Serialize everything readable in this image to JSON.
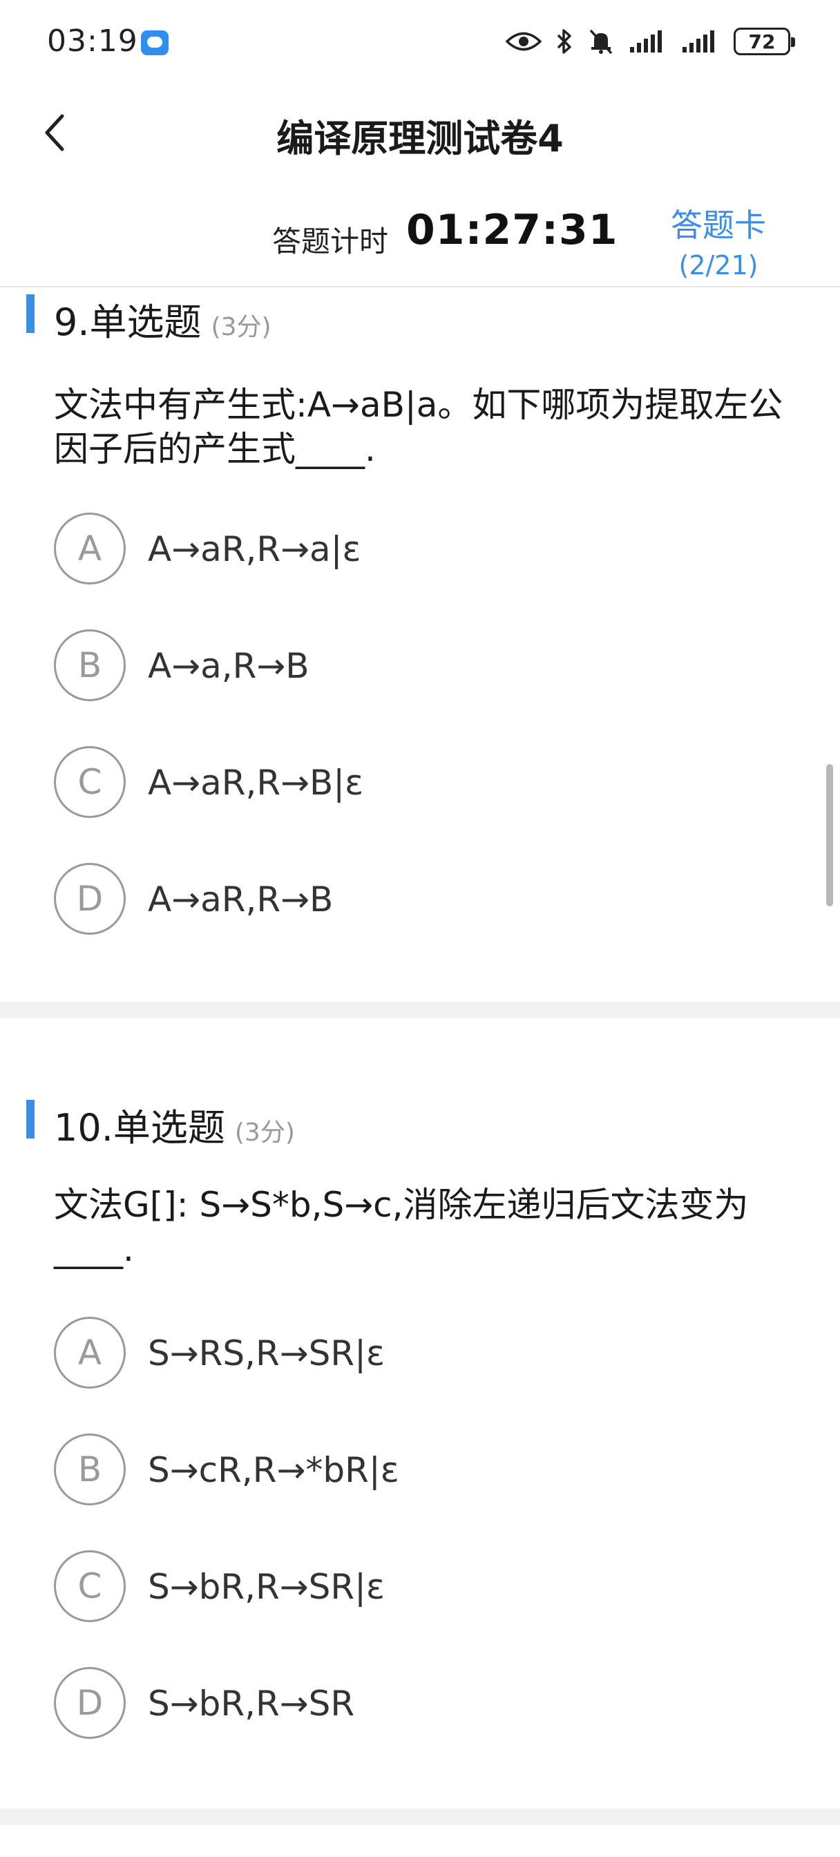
{
  "status_bar": {
    "time": "03:19",
    "battery": "72",
    "icons": [
      "message-icon",
      "eye-icon",
      "bluetooth-icon",
      "mute-icon",
      "signal-icon",
      "battery-icon"
    ]
  },
  "header": {
    "title": "编译原理测试卷4",
    "back_icon": "chevron-left-icon"
  },
  "timer": {
    "label": "答题计时",
    "value": "01:27:31"
  },
  "answer_card": {
    "label": "答题卡",
    "count": "(2/21)"
  },
  "questions": [
    {
      "title": "9.单选题",
      "score": "(3分)",
      "stem": "文法中有产生式:A→aB|a。如下哪项为提取左公因子后的产生式____.",
      "options": [
        {
          "letter": "A",
          "text": "A→aR,R→a|ε"
        },
        {
          "letter": "B",
          "text": "A→a,R→B"
        },
        {
          "letter": "C",
          "text": "A→aR,R→B|ε"
        },
        {
          "letter": "D",
          "text": "A→aR,R→B"
        }
      ]
    },
    {
      "title": "10.单选题",
      "score": "(3分)",
      "stem": "文法G[]: S→S*b,S→c,消除左递归后文法变为____.",
      "options": [
        {
          "letter": "A",
          "text": "S→RS,R→SR|ε"
        },
        {
          "letter": "B",
          "text": "S→cR,R→*bR|ε"
        },
        {
          "letter": "C",
          "text": "S→bR,R→SR|ε"
        },
        {
          "letter": "D",
          "text": "S→bR,R→SR"
        }
      ]
    }
  ],
  "colors": {
    "accent": "#3a8ee6",
    "option_border": "#9a9a9a",
    "divider": "#f2f2f2"
  }
}
